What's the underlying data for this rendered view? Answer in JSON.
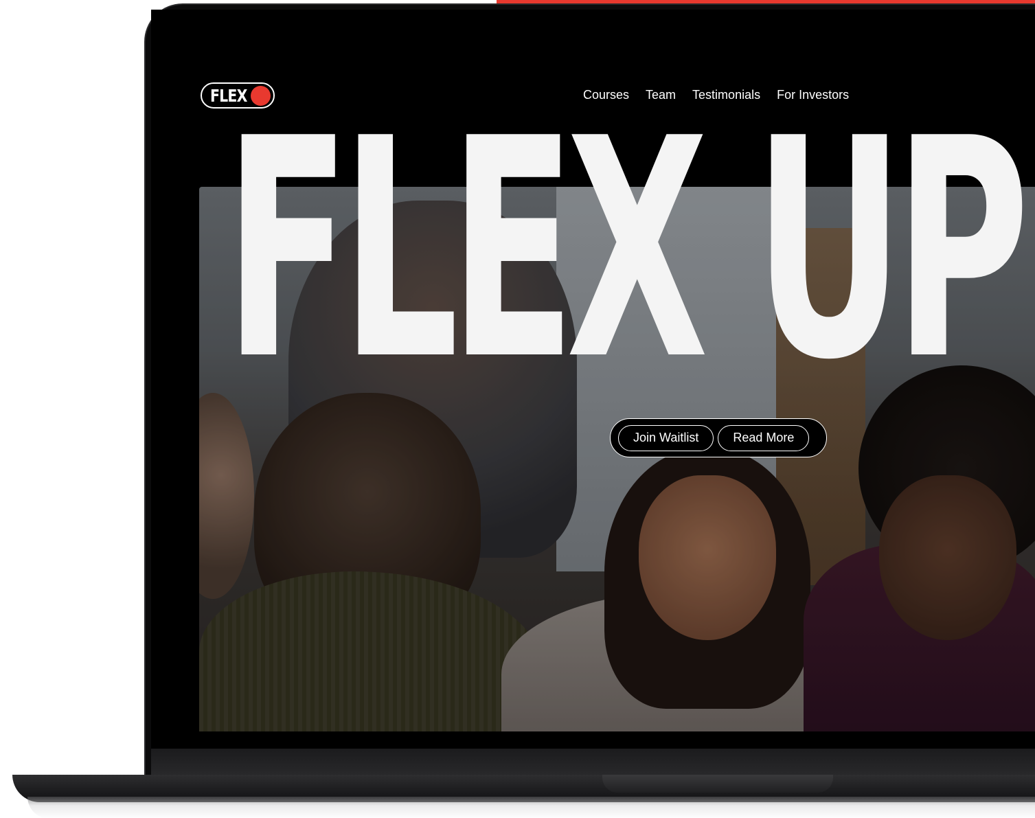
{
  "site": {
    "logo_text": "FLEX",
    "accent_color": "#e8392f"
  },
  "nav": {
    "items": [
      {
        "label": "Courses"
      },
      {
        "label": "Team"
      },
      {
        "label": "Testimonials"
      },
      {
        "label": "For Investors"
      }
    ]
  },
  "hero": {
    "title": "FLEX UP",
    "photo": "students-group-study-photo",
    "buttons": {
      "join_waitlist": "Join Waitlist",
      "read_more": "Read More"
    }
  }
}
